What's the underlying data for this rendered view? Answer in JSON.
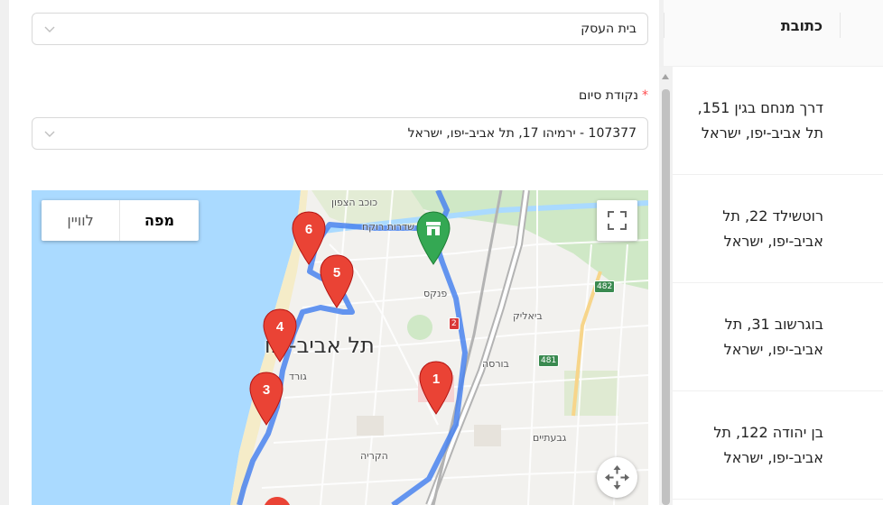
{
  "form": {
    "start_select": {
      "value": "בית העסק"
    },
    "end_label": "נקודת סיום",
    "end_select": {
      "value": "107377 - ירמיהו 17, תל אביב-יפו, ישראל"
    }
  },
  "map": {
    "map_type_buttons": {
      "map": "מפה",
      "satellite": "לוויין"
    },
    "city_label": "תל אביב-יפו",
    "place_labels": {
      "kochav_hatzafon": "כוכב הצפון",
      "sderot_rokach": "שדרות רוקח",
      "pinkas": "פנקס",
      "bialik": "ביאליק",
      "bursa": "בורסה",
      "givatayim": "גבעתיים",
      "kirya": "הקריה",
      "gordon": "גורד"
    },
    "road_badges": {
      "r482": "482",
      "r481": "481",
      "r2": "2"
    },
    "markers": [
      "1",
      "3",
      "4",
      "5",
      "6"
    ],
    "colors": {
      "route": "#4a84ef",
      "marker": "#ea4335",
      "start_pin": "#34a853",
      "sea": "#aadaff"
    }
  },
  "table": {
    "header": "כתובת",
    "rows": [
      {
        "address": "דרך מנחם בגין 151, תל אביב-יפו, ישראל"
      },
      {
        "address": "רוטשילד 22, תל אביב-יפו, ישראל"
      },
      {
        "address": "בוגרשוב 31, תל אביב-יפו, ישראל"
      },
      {
        "address": "בן יהודה 122, תל אביב-יפו, ישראל"
      }
    ]
  }
}
